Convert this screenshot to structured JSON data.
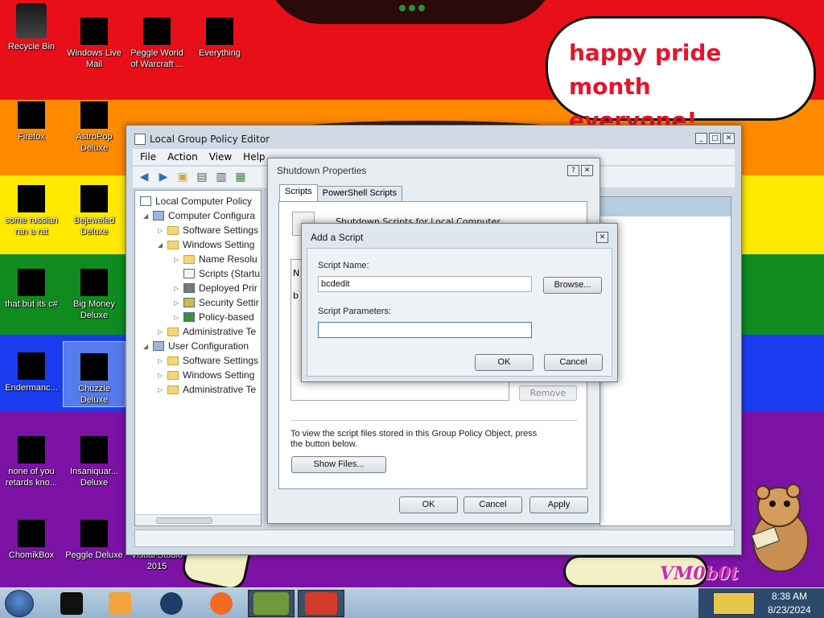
{
  "colors": {
    "stripe_red": "#e80f19",
    "stripe_orange": "#ff8a00",
    "stripe_yellow": "#ffe900",
    "stripe_green": "#0f8b20",
    "stripe_blue": "#1a3cf0",
    "stripe_purple": "#7c12a6"
  },
  "speech_bubble": {
    "line1": "happy pride month",
    "line2": "everyone!"
  },
  "watermark": "VM0b0t",
  "desktop_icons": [
    {
      "label": "Recycle Bin",
      "icon": "recycle-bin-icon"
    },
    {
      "label": "Windows Live Mail",
      "icon": "mail-icon"
    },
    {
      "label": "Peggle World of Warcraft ...",
      "icon": "game-icon"
    },
    {
      "label": "Everything",
      "icon": "search-icon"
    },
    {
      "label": "Firefox",
      "icon": "firefox-icon"
    },
    {
      "label": "AstroPop Deluxe",
      "icon": "game-icon"
    },
    {
      "label": "some russian ran a rat",
      "icon": "app-icon"
    },
    {
      "label": "Bejeweled Deluxe",
      "icon": "game-icon"
    },
    {
      "label": "that but its c#",
      "icon": "app-icon"
    },
    {
      "label": "Big Money Deluxe",
      "icon": "game-icon"
    },
    {
      "label": "Endermanc...",
      "icon": "app-icon"
    },
    {
      "label": "Chuzzle Deluxe",
      "icon": "game-icon"
    },
    {
      "label": "none of you retards kno...",
      "icon": "app-icon"
    },
    {
      "label": "Insaniquar... Deluxe",
      "icon": "game-icon"
    },
    {
      "label": "ChomikBox",
      "icon": "chomikbox-icon"
    },
    {
      "label": "Peggle Deluxe",
      "icon": "game-icon"
    },
    {
      "label": "Visual Studio 2015",
      "icon": "visual-studio-icon"
    }
  ],
  "gpo_window": {
    "title": "Local Group Policy Editor",
    "menu": [
      "File",
      "Action",
      "View",
      "Help"
    ],
    "tree": [
      {
        "label": "Local Computer Policy"
      },
      {
        "label": "Computer Configura"
      },
      {
        "label": "Software Settings"
      },
      {
        "label": "Windows Setting"
      },
      {
        "label": "Name Resolu"
      },
      {
        "label": "Scripts (Startu"
      },
      {
        "label": "Deployed Prir"
      },
      {
        "label": "Security Settir"
      },
      {
        "label": "Policy-based"
      },
      {
        "label": "Administrative Te"
      },
      {
        "label": "User Configuration"
      },
      {
        "label": "Software Settings"
      },
      {
        "label": "Windows Setting"
      },
      {
        "label": "Administrative Te"
      }
    ]
  },
  "shutdown_dialog": {
    "title": "Shutdown Properties",
    "tabs": [
      "Scripts",
      "PowerShell Scripts"
    ],
    "heading": "Shutdown Scripts for Local Computer",
    "list_header": "N",
    "list_row": "b",
    "remove_label": "Remove",
    "info_text": "To view the script files stored in this Group Policy Object, press the button below.",
    "show_files_label": "Show Files...",
    "ok_label": "OK",
    "cancel_label": "Cancel",
    "apply_label": "Apply"
  },
  "add_script_dialog": {
    "title": "Add a Script",
    "script_name_label": "Script Name:",
    "script_name_value": "bcdedit",
    "browse_label": "Browse...",
    "script_params_label": "Script Parameters:",
    "script_params_value": "",
    "ok_label": "OK",
    "cancel_label": "Cancel"
  },
  "taskbar": {
    "clock_time": "8:38 AM",
    "clock_date": "8/23/2024",
    "items": [
      "terminal-icon",
      "media-player-icon",
      "browser-icon",
      "firefox-icon",
      "chomikbox-icon",
      "toolbox-icon"
    ]
  }
}
